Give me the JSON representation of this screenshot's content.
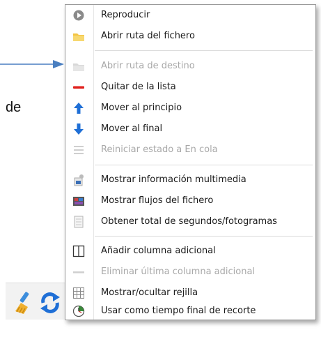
{
  "background": {
    "text": "de"
  },
  "menu": {
    "items": [
      {
        "label": "Reproducir",
        "enabled": true,
        "icon": "play-icon"
      },
      {
        "label": "Abrir ruta del fichero",
        "enabled": true,
        "icon": "folder-icon"
      },
      {
        "label": "Abrir ruta de destino",
        "enabled": false,
        "icon": "folder-disabled-icon"
      },
      {
        "label": "Quitar de la lista",
        "enabled": true,
        "icon": "remove-icon"
      },
      {
        "label": "Mover al principio",
        "enabled": true,
        "icon": "arrow-up-icon"
      },
      {
        "label": "Mover al final",
        "enabled": true,
        "icon": "arrow-down-icon"
      },
      {
        "label": "Reiniciar estado a En cola",
        "enabled": false,
        "icon": "reset-queue-icon"
      },
      {
        "label": "Mostrar información multimedia",
        "enabled": true,
        "icon": "media-info-icon"
      },
      {
        "label": "Mostrar flujos del fichero",
        "enabled": true,
        "icon": "streams-icon"
      },
      {
        "label": "Obtener total de segundos/fotogramas",
        "enabled": true,
        "icon": "frames-icon"
      },
      {
        "label": "Añadir columna adicional",
        "enabled": true,
        "icon": "add-column-icon"
      },
      {
        "label": "Eliminar última columna adicional",
        "enabled": false,
        "icon": "remove-column-icon"
      },
      {
        "label": "Mostrar/ocultar rejilla",
        "enabled": true,
        "icon": "grid-icon"
      },
      {
        "label": "Usar como tiempo final de recorte",
        "enabled": true,
        "icon": "clock-icon"
      }
    ]
  },
  "colors": {
    "arrow": "#4a7fc0",
    "remove": "#e0201c",
    "move_arrow": "#1f6fd6"
  }
}
